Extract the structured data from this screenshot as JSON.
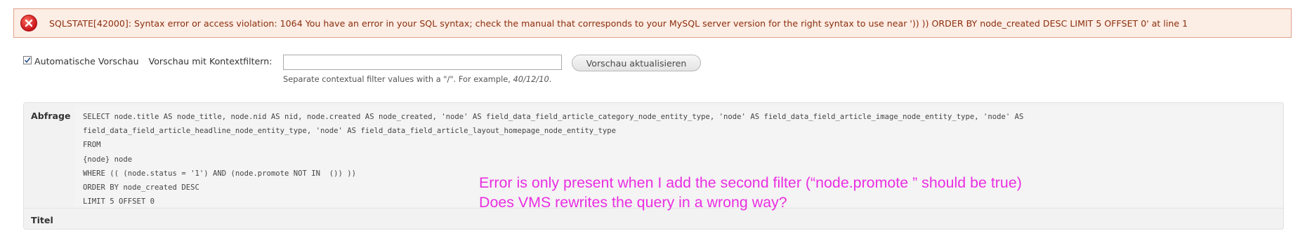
{
  "error": {
    "icon": "error-x-icon",
    "message": "SQLSTATE[42000]: Syntax error or access violation: 1064 You have an error in your SQL syntax; check the manual that corresponds to your MySQL server version for the right syntax to use near ')) )) ORDER BY node_created DESC LIMIT 5 OFFSET 0' at line 1"
  },
  "preview": {
    "auto_preview_checked": true,
    "auto_preview_label": "Automatische Vorschau",
    "context_filter_label": "Vorschau mit Kontextfiltern:",
    "context_filter_value": "",
    "update_button_label": "Vorschau aktualisieren",
    "help_text_prefix": "Separate contextual filter values with a \"/\". For example, ",
    "help_text_example": "40/12/10",
    "help_text_suffix": "."
  },
  "query": {
    "label": "Abfrage",
    "lines": [
      "SELECT node.title AS node_title, node.nid AS nid, node.created AS node_created, 'node' AS field_data_field_article_category_node_entity_type, 'node' AS field_data_field_article_image_node_entity_type, 'node' AS",
      "field_data_field_article_headline_node_entity_type, 'node' AS field_data_field_article_layout_homepage_node_entity_type",
      "FROM",
      "{node} node",
      "WHERE (( (node.status = '1') AND (node.promote NOT IN  ()) ))",
      "ORDER BY node_created DESC",
      "LIMIT 5 OFFSET 0"
    ],
    "title_label": "Titel"
  },
  "annotation": {
    "line1": "Error is only present when I add the second filter (“node.promote ” should be true)",
    "line2": "Does VMS rewrites the query in a wrong way?",
    "color": "#ea2ee2"
  }
}
